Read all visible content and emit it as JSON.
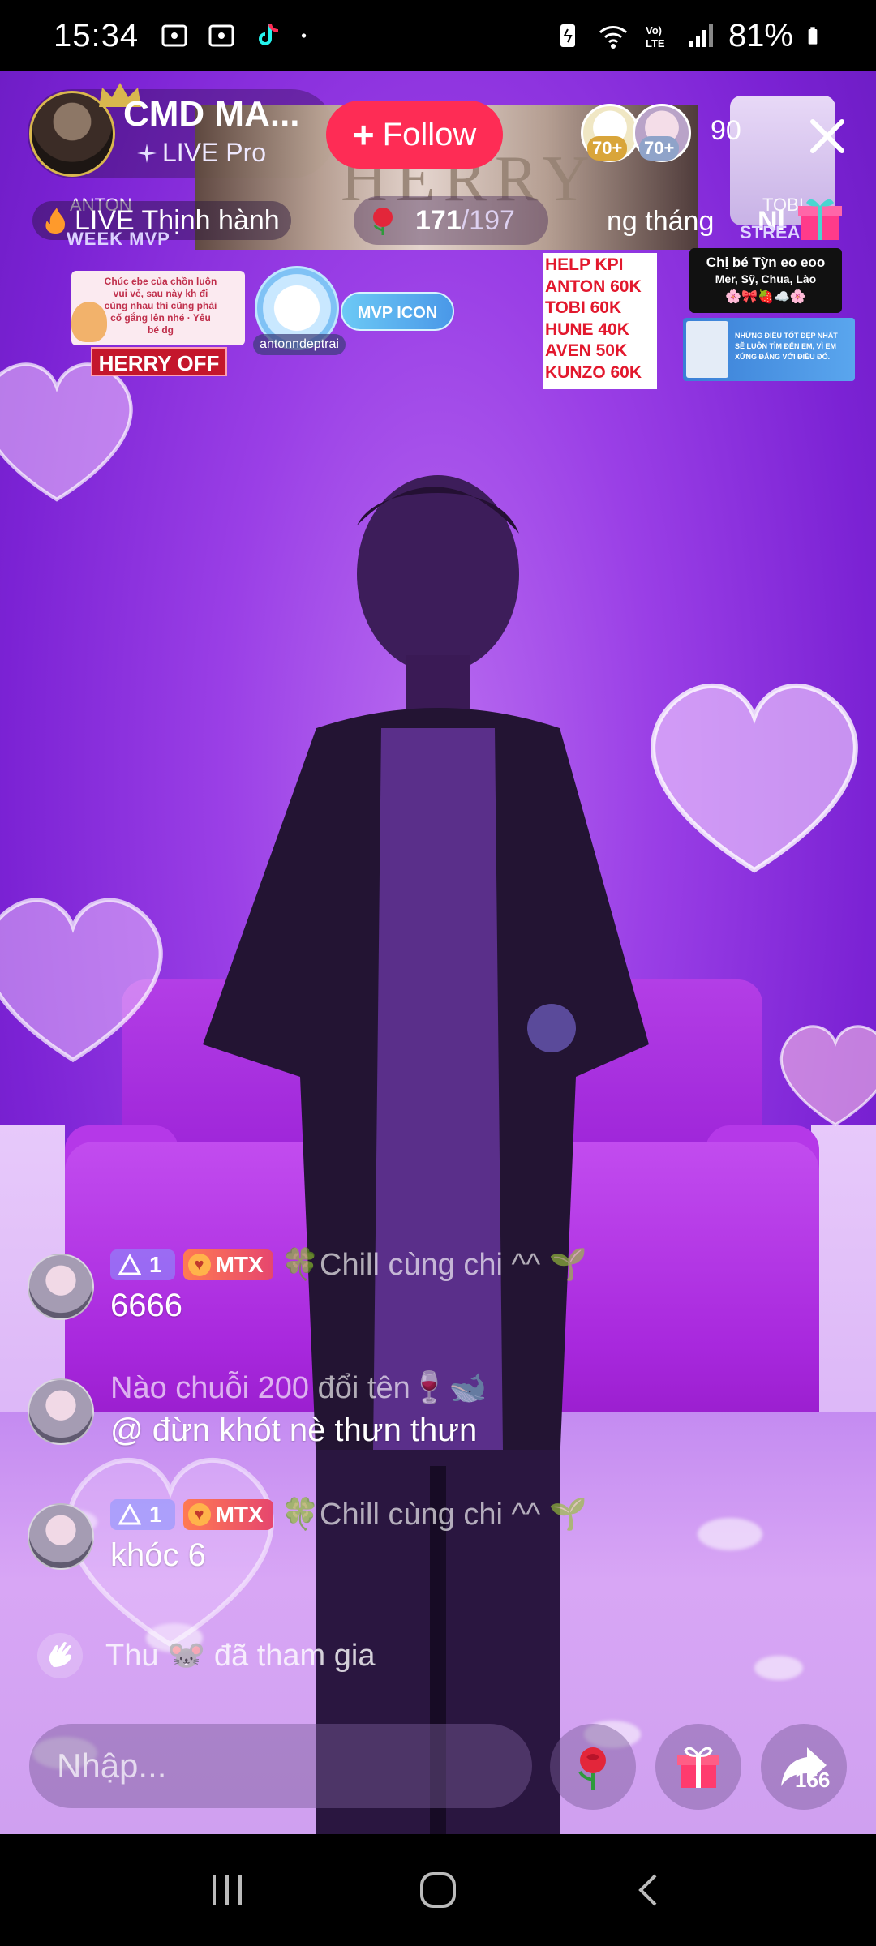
{
  "status_bar": {
    "time": "15:34",
    "battery": "81%",
    "icons": [
      "screenshot-icon",
      "screenshot-icon",
      "tiktok-icon",
      "dot-icon",
      "data-saver-icon",
      "wifi-icon",
      "volte-icon",
      "signal-icon",
      "battery-icon"
    ]
  },
  "host": {
    "name": "CMD MA...",
    "subtitle": "LIVE Pro",
    "follow_label": "Follow"
  },
  "banner_text": "HERRY",
  "viewers": {
    "badge_1": "70+",
    "badge_2": "70+",
    "count": "90"
  },
  "row2": {
    "anton_tag": "ANTON",
    "tobi_tag": "TOBI",
    "trending_label": "LIVE Thịnh hành",
    "week_mvp": "WEEK MVP",
    "rose_current": "171",
    "rose_goal": "/197",
    "ranking_label": "ng tháng",
    "ni_label": "Nl",
    "streak_label": "STREAK"
  },
  "stickers": {
    "note_text": "Chúc ebe của chồn luôn vui vẻ, sau này kh đi cùng nhau thì cũng phải cố gắng lên nhé · Yêu bé dg",
    "herry_off": "HERRY OFF",
    "mvp_label": "MVP ICON",
    "mvp_user": "antonndeptrai",
    "kpi_lines": [
      "HELP KPI",
      "ANTON 60K",
      "TOBI 60K",
      "HUNE 40K",
      "AVEN 50K",
      "KUNZO 60K"
    ],
    "chibe_title": "Chị bé Tỳn eo eoo",
    "chibe_sub": "Mer, Sỹ, Chua, Lào",
    "chibe_emoji": "🌸🎀🍓☁️🌸",
    "quote_text": "NHỮNG ĐIỀU TỐT ĐẸP NHẤT SẼ LUÔN TÌM ĐẾN EM, VÌ EM XỨNG ĐÁNG VỚI ĐIỀU ĐÓ."
  },
  "chat": [
    {
      "level": "1",
      "fan_badge": "MTX",
      "username": "🍀Chill cùng chi ^^ 🌱",
      "message": "6666"
    },
    {
      "username": "Nào chuỗi 200 đổi tên🍷🐋",
      "message": "@ đừn khót nè thưn thưn"
    },
    {
      "level": "1",
      "fan_badge": "MTX",
      "username": "🍀Chill cùng chi ^^ 🌱",
      "message": "khóc 6"
    }
  ],
  "join_message": "Thu 🐭 đã tham gia",
  "bottom_bar": {
    "input_placeholder": "Nhập...",
    "share_count": "166"
  },
  "colors": {
    "follow": "#fe2c55",
    "accent_purple": "#8a2be2"
  }
}
